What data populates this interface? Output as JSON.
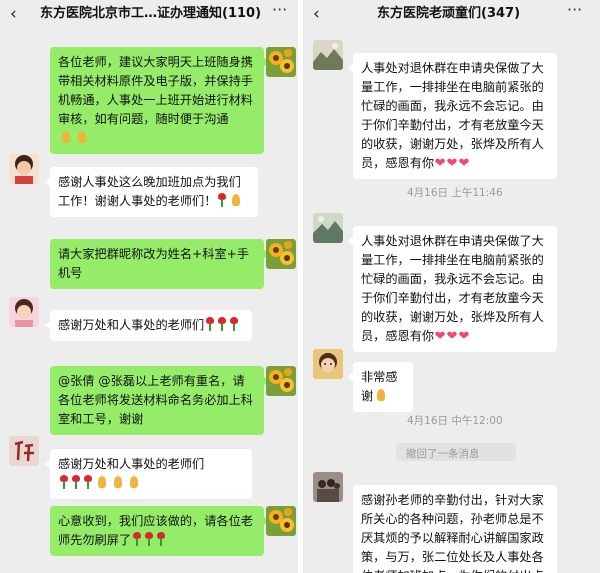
{
  "left_chat": {
    "title": "东方医院北京市工…证办理通知(110)",
    "back_icon": "‹",
    "more_icon": "···",
    "messages": [
      {
        "side": "out",
        "text": "各位老师，建议大家明天上班随身携带相关材料原件及电子版，并保持手机畅通，人事处一上班开始进行材料审核，如有问题，随时便于沟通",
        "emoji": "pray-pray"
      },
      {
        "side": "in",
        "text": "感谢人事处这么晚加班加点为我们工作！谢谢人事处的老师们！",
        "emoji": "rose-pray"
      },
      {
        "side": "out",
        "text": "请大家把群昵称改为姓名+科室+手机号"
      },
      {
        "side": "in",
        "text": "感谢万处和人事处的老师们",
        "emoji": "rose-rose-rose"
      },
      {
        "side": "out",
        "text": "@张倩 @张磊以上老师有重名，请各位老师将发送材料命名务必加上科室和工号，谢谢"
      },
      {
        "side": "in",
        "text": "感谢万处和人事处的老师们",
        "emoji": "rose-rose-rose-pray-pray-pray"
      },
      {
        "side": "out",
        "text": "心意收到，我们应该做的，请各位老师先勿刷屏了",
        "emoji": "rose-rose-rose"
      }
    ]
  },
  "right_chat": {
    "title": "东方医院老顽童们(347)",
    "back_icon": "‹",
    "more_icon": "···",
    "messages": [
      {
        "side": "in",
        "text": "人事处对退休群在申请央保做了大量工作，一排排坐在电脑前紧张的忙碌的画面，我永远不会忘记。由于你们辛勤付出，才有老放童今天的收获，谢谢万处，张烨及所有人员，感恩有你",
        "emoji": "heart-heart-heart"
      },
      {
        "side": "in",
        "text": "人事处对退休群在申请央保做了大量工作，一排排坐在电脑前紧张的忙碌的画面，我永远不会忘记。由于你们辛勤付出，才有老放童今天的收获，谢谢万处，张烨及所有人员，感恩有你",
        "emoji": "heart-heart-heart"
      },
      {
        "side": "in",
        "text": "非常感谢",
        "emoji": "pray"
      },
      {
        "side": "in",
        "text": "感谢孙老师的辛勤付出，针对大家所关心的各种问题，孙老师总是不厌其烦的予以解释耐心讲解国家政策，与万，张二位处长及人事处各位老师加班加点，为你们的付出点"
      }
    ],
    "timestamps": [
      "4月16日 上午11:46",
      "4月16日 中午12:00"
    ],
    "recall_notice": "撤回了一条消息"
  },
  "colors": {
    "outgoing_bubble": "#95ec69",
    "incoming_bubble": "#ffffff",
    "background": "#ededed"
  }
}
